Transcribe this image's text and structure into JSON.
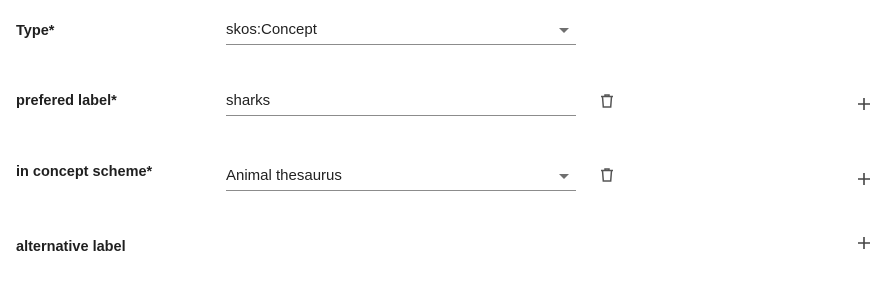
{
  "form": {
    "type": {
      "label": "Type*",
      "value": "skos:Concept",
      "control": "select"
    },
    "prefered_label": {
      "label": "prefered label*",
      "value": "sharks",
      "control": "text",
      "actions": [
        "trash-icon",
        "plus-icon"
      ]
    },
    "in_concept_scheme": {
      "label": "in concept scheme*",
      "value": "Animal thesaurus",
      "control": "select",
      "actions": [
        "trash-icon",
        "plus-icon"
      ]
    },
    "alternative_label": {
      "label": "alternative label",
      "actions": [
        "plus-icon"
      ]
    }
  },
  "colors": {
    "text": "#1f1f1f",
    "underline": "#8c8c8c",
    "icon": "#555555"
  }
}
